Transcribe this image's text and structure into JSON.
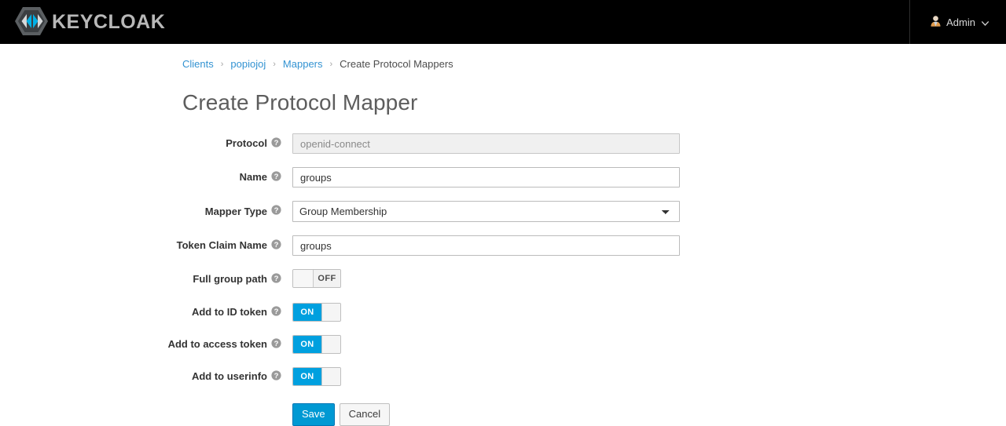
{
  "navbar": {
    "brand_name": "KEYCLOAK",
    "brand_logo_icon": "keycloak-hexagon-logo",
    "user_icon": "user-avatar-icon",
    "user_label": "Admin",
    "caret_icon": "chevron-down-icon",
    "background_color": "#000000",
    "brand_text_color": "#b8b8b8"
  },
  "breadcrumb": {
    "items": [
      {
        "label": "Clients",
        "link": true
      },
      {
        "label": "popiojoj",
        "link": true
      },
      {
        "label": "Mappers",
        "link": true
      },
      {
        "label": "Create Protocol Mappers",
        "link": false
      }
    ],
    "separator": "›",
    "link_color": "#3393d2",
    "active_color": "#4d4d4d"
  },
  "page": {
    "title": "Create Protocol Mapper"
  },
  "form": {
    "help_icon": "question-circle-icon",
    "fields": {
      "protocol": {
        "label": "Protocol",
        "value": "openid-connect",
        "disabled": true
      },
      "name": {
        "label": "Name",
        "value": "groups"
      },
      "mapper_type": {
        "label": "Mapper Type",
        "value": "Group Membership",
        "options": [
          "Group Membership"
        ],
        "caret_icon": "chevron-down-icon"
      },
      "token_claim_name": {
        "label": "Token Claim Name",
        "value": "groups"
      },
      "full_group_path": {
        "label": "Full group path",
        "state": "OFF"
      },
      "add_to_id_token": {
        "label": "Add to ID token",
        "state": "ON"
      },
      "add_to_access_token": {
        "label": "Add to access token",
        "state": "ON"
      },
      "add_to_userinfo": {
        "label": "Add to userinfo",
        "state": "ON"
      }
    },
    "buttons": {
      "save": "Save",
      "cancel": "Cancel"
    },
    "colors": {
      "toggle_on": "#00a0df",
      "save_button": "#0099d3"
    }
  }
}
